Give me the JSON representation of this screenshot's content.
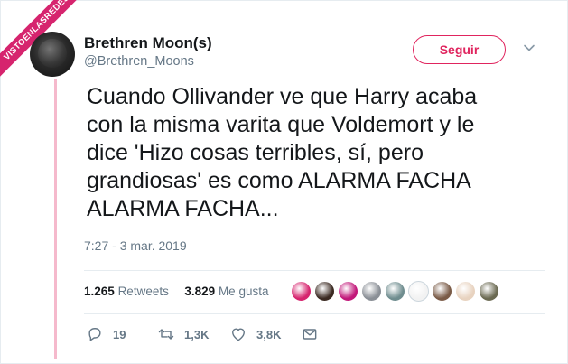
{
  "watermark": {
    "ribbon_text": "VISTOENLASREDES"
  },
  "author": {
    "display_name": "Brethren Moon(s)",
    "handle": "@Brethren_Moons"
  },
  "follow_button": {
    "label": "Seguir"
  },
  "tweet": {
    "text": "Cuando Ollivander ve que Harry acaba\ncon la misma varita que Voldemort y le\ndice 'Hizo cosas terribles, sí, pero\ngrandiosas' es como ALARMA FACHA\nALARMA FACHA...",
    "timestamp": "7:27 - 3 mar. 2019"
  },
  "stats": {
    "retweets_count": "1.265",
    "retweets_label": "Retweets",
    "likes_count": "3.829",
    "likes_label": "Me gusta"
  },
  "liker_avatars": [
    {
      "icon": "avatar-pink-circle",
      "color": "#d6246e"
    },
    {
      "icon": "avatar-dark-photo",
      "color": "#3b2a22"
    },
    {
      "icon": "avatar-magenta-circle",
      "color": "#c2187a"
    },
    {
      "icon": "avatar-gray-photo",
      "color": "#8a8f96"
    },
    {
      "icon": "avatar-teal-photo",
      "color": "#6f8d8f"
    },
    {
      "icon": "avatar-music-note",
      "color": "#f2f2f2"
    },
    {
      "icon": "avatar-brown-photo",
      "color": "#7a5b47"
    },
    {
      "icon": "avatar-anime",
      "color": "#e8d3c0"
    },
    {
      "icon": "avatar-olive-photo",
      "color": "#6b6a52"
    }
  ],
  "actions": {
    "reply_count": "19",
    "retweet_count": "1,3K",
    "like_count": "3,8K"
  },
  "colors": {
    "accent_red": "#e0245e",
    "ribbon_pink": "#d6246e",
    "secondary_text": "#657786"
  }
}
